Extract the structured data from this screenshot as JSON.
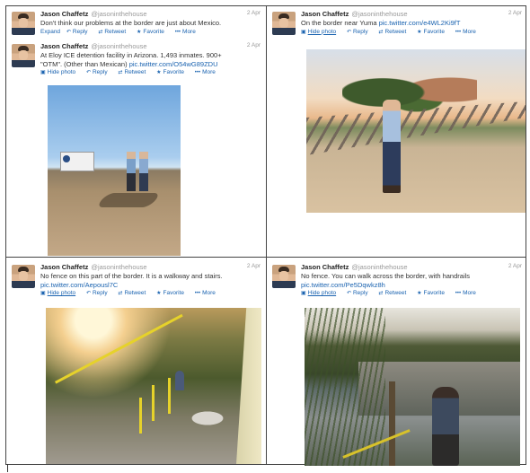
{
  "tweets": [
    {
      "name": "Jason Chaffetz",
      "handle": "@jasoninthehouse",
      "date": "2 Apr",
      "text": "Don't think our problems at the border are just about Mexico.",
      "actions": {
        "expand": "Expand",
        "reply": "Reply",
        "retweet": "Retweet",
        "favorite": "Favorite",
        "more": "More"
      }
    },
    {
      "name": "Jason Chaffetz",
      "handle": "@jasoninthehouse",
      "date": "2 Apr",
      "text": "At Eloy ICE detention facility in Arizona. 1,493 inmates. 900+ \"OTM\". (Other than Mexican)",
      "link": "pic.twitter.com/O54wG89ZDU",
      "actions": {
        "hide_photo": "Hide photo",
        "reply": "Reply",
        "retweet": "Retweet",
        "favorite": "Favorite",
        "more": "More"
      }
    },
    {
      "name": "Jason Chaffetz",
      "handle": "@jasoninthehouse",
      "date": "2 Apr",
      "text": "On the border near Yuma",
      "link": "pic.twitter.com/e4WL2Ki9fT",
      "actions": {
        "hide_photo": "Hide photo",
        "reply": "Reply",
        "retweet": "Retweet",
        "favorite": "Favorite",
        "more": "More"
      }
    },
    {
      "name": "Jason Chaffetz",
      "handle": "@jasoninthehouse",
      "date": "2 Apr",
      "text": "No fence on this part of the border. It is a walkway and stairs.",
      "link": "pic.twitter.com/Aepousl7C",
      "actions": {
        "hide_photo": "Hide photo",
        "reply": "Reply",
        "retweet": "Retweet",
        "favorite": "Favorite",
        "more": "More"
      }
    },
    {
      "name": "Jason Chaffetz",
      "handle": "@jasoninthehouse",
      "date": "2 Apr",
      "text": "No fence. You can walk across the border, with handrails",
      "link": "pic.twitter.com/Pe5Dqwkz8h",
      "actions": {
        "hide_photo": "Hide photo",
        "reply": "Reply",
        "retweet": "Retweet",
        "favorite": "Favorite",
        "more": "More"
      }
    }
  ],
  "icons": {
    "reply": "reply-arrow-icon",
    "retweet": "retweet-icon",
    "favorite": "star-icon",
    "more": "more-dots-icon",
    "photo": "photo-icon"
  },
  "colors": {
    "link": "#1a63b0",
    "muted": "#999999",
    "border": "#444444"
  }
}
